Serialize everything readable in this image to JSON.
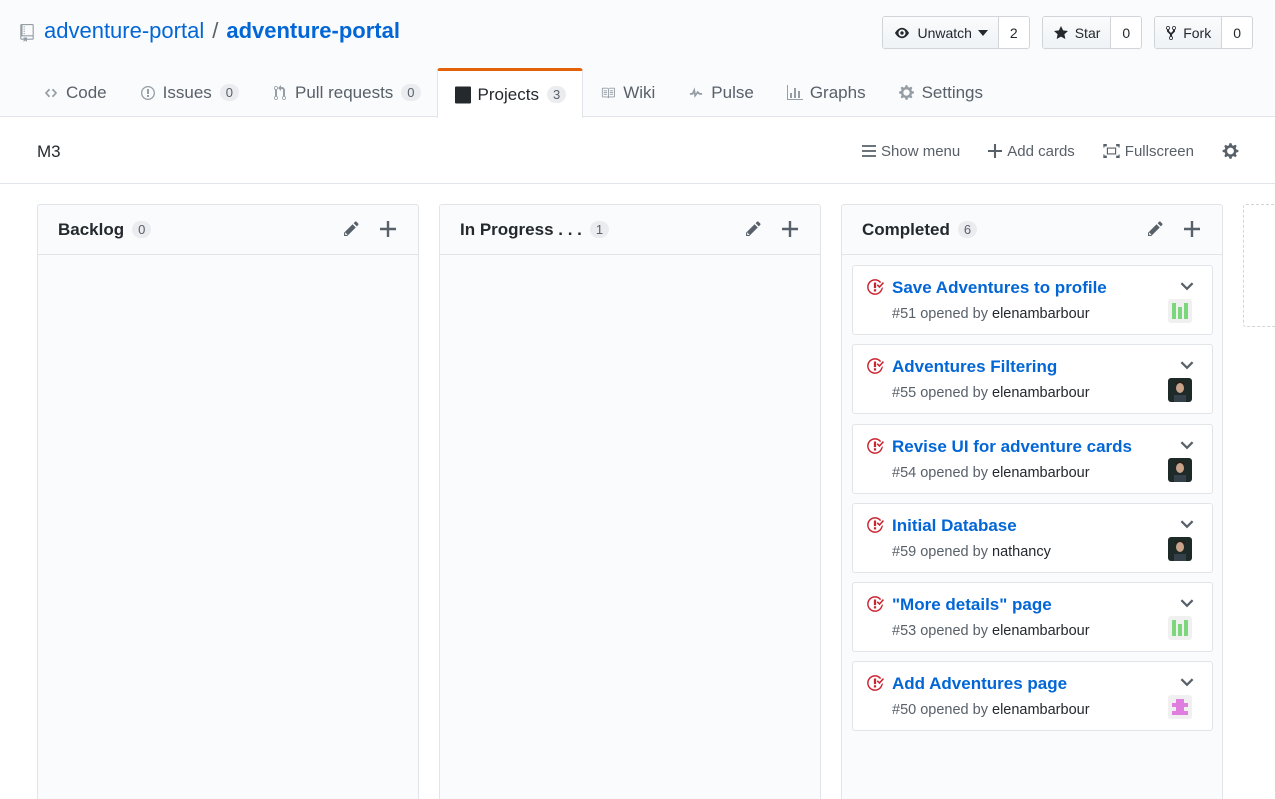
{
  "repo": {
    "owner": "adventure-portal",
    "separator": "/",
    "name": "adventure-portal"
  },
  "actions": {
    "watch": {
      "label": "Unwatch",
      "count": "2"
    },
    "star": {
      "label": "Star",
      "count": "0"
    },
    "fork": {
      "label": "Fork",
      "count": "0"
    }
  },
  "tabs": [
    {
      "label": "Code",
      "icon": "code-icon",
      "counter": ""
    },
    {
      "label": "Issues",
      "icon": "issue-icon",
      "counter": "0"
    },
    {
      "label": "Pull requests",
      "icon": "pull-request-icon",
      "counter": "0"
    },
    {
      "label": "Projects",
      "icon": "project-icon",
      "counter": "3",
      "selected": true
    },
    {
      "label": "Wiki",
      "icon": "book-icon",
      "counter": ""
    },
    {
      "label": "Pulse",
      "icon": "pulse-icon",
      "counter": ""
    },
    {
      "label": "Graphs",
      "icon": "graph-icon",
      "counter": ""
    },
    {
      "label": "Settings",
      "icon": "gear-icon",
      "counter": ""
    }
  ],
  "project": {
    "name": "M3",
    "tools": {
      "menu": "Show menu",
      "add": "Add cards",
      "fullscreen": "Fullscreen"
    }
  },
  "columns": [
    {
      "title": "Backlog",
      "count": "0",
      "cards": []
    },
    {
      "title": "In Progress . . .",
      "count": "1",
      "cards": []
    },
    {
      "title": "Completed",
      "count": "6",
      "cards": [
        {
          "title": "Save Adventures to profile",
          "number": "#51",
          "opened_by": "opened by",
          "user": "elenambarbour",
          "avatar": "green-identicon"
        },
        {
          "title": "Adventures Filtering",
          "number": "#55",
          "opened_by": "opened by",
          "user": "elenambarbour",
          "avatar": "photo-avatar"
        },
        {
          "title": "Revise UI for adventure cards",
          "number": "#54",
          "opened_by": "opened by",
          "user": "elenambarbour",
          "avatar": "photo-avatar"
        },
        {
          "title": "Initial Database",
          "number": "#59",
          "opened_by": "opened by",
          "user": "nathancy",
          "avatar": "photo-avatar"
        },
        {
          "title": "\"More details\" page",
          "number": "#53",
          "opened_by": "opened by",
          "user": "elenambarbour",
          "avatar": "green-identicon"
        },
        {
          "title": "Add Adventures page",
          "number": "#50",
          "opened_by": "opened by",
          "user": "elenambarbour",
          "avatar": "pink-identicon"
        }
      ]
    }
  ],
  "colors": {
    "link": "#0366d6",
    "closed_issue": "#cb2431",
    "selected_tab": "#e36209",
    "identicon_green": "#7cd67c",
    "identicon_pink": "#e07ee0"
  }
}
